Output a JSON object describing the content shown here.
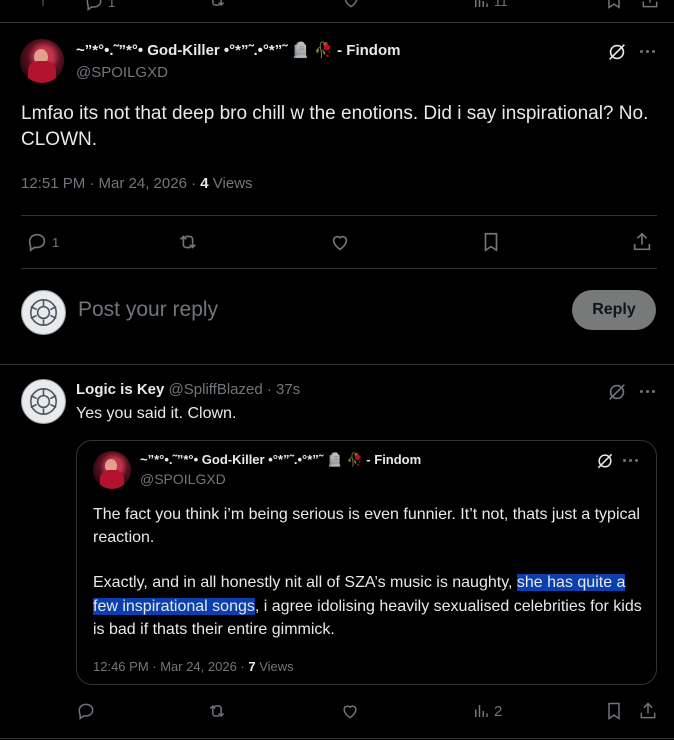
{
  "top_action_bar": {
    "reply_count": "1",
    "views_count": "11"
  },
  "main_tweet": {
    "display_name": "~”*°•.˜”*°• God-Killer •°*”˜.•°*”˜ 🪦 🥀 - Findom",
    "handle": "@SPOILGXD",
    "text": "Lmfao its not that deep bro chill w the enotions. Did i say inspirational? No. CLOWN.",
    "timestamp": "12:51 PM · Mar 24, 2026 ·",
    "views_number": "4",
    "views_label": "Views",
    "reply_count": "1"
  },
  "reply_composer": {
    "placeholder": "Post your reply",
    "button_label": "Reply"
  },
  "reply_tweet": {
    "display_name": "Logic is Key",
    "handle": "@SpliffBlazed",
    "time": "· 37s",
    "text": "Yes you said it. Clown.",
    "views_count": "2"
  },
  "quoted_tweet": {
    "display_name": "~”*°•.˜”*°• God-Killer •°*”˜.•°*”˜ 🪦 🥀 - Findom",
    "handle": "@SPOILGXD",
    "paragraph1": "The fact you think i’m being serious is even funnier. It’t not, thats just a typical reaction.",
    "paragraph2_before": "Exactly, and in all honestly nit all of SZA’s music is naughty, ",
    "paragraph2_highlight": "she has quite a few inspirational songs",
    "paragraph2_after": ", i agree idolising heavily sexualised celebrities for kids is bad if thats their entire gimmick.",
    "timestamp": "12:46 PM · Mar 24, 2026 ·",
    "views_number": "7",
    "views_label": "Views"
  },
  "colors": {
    "background": "#000000",
    "text": "#e7e9ea",
    "muted": "#71767b",
    "divider": "#2f3336",
    "highlight": "#0b3fae",
    "reply_button": "#787a7a"
  }
}
